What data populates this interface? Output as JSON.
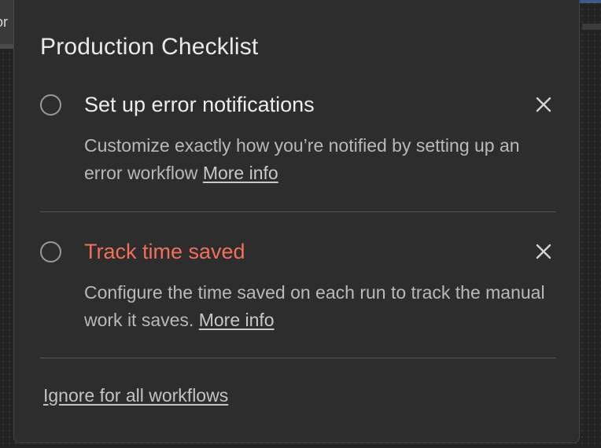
{
  "background": {
    "tab_label": "or"
  },
  "checklist": {
    "title": "Production Checklist",
    "items": [
      {
        "title": "Set up error notifications",
        "description": "Customize exactly how you’re notified by setting up an error workflow",
        "link_label": "More info",
        "close_icon": "close-icon",
        "title_color": "#ededed"
      },
      {
        "title": "Track time saved",
        "description": "Configure the time saved on each run to track the manual work it saves.",
        "link_label": "More info",
        "close_icon": "close-icon",
        "title_color": "#f0715a"
      }
    ],
    "ignore_label": "Ignore for all workflows"
  }
}
